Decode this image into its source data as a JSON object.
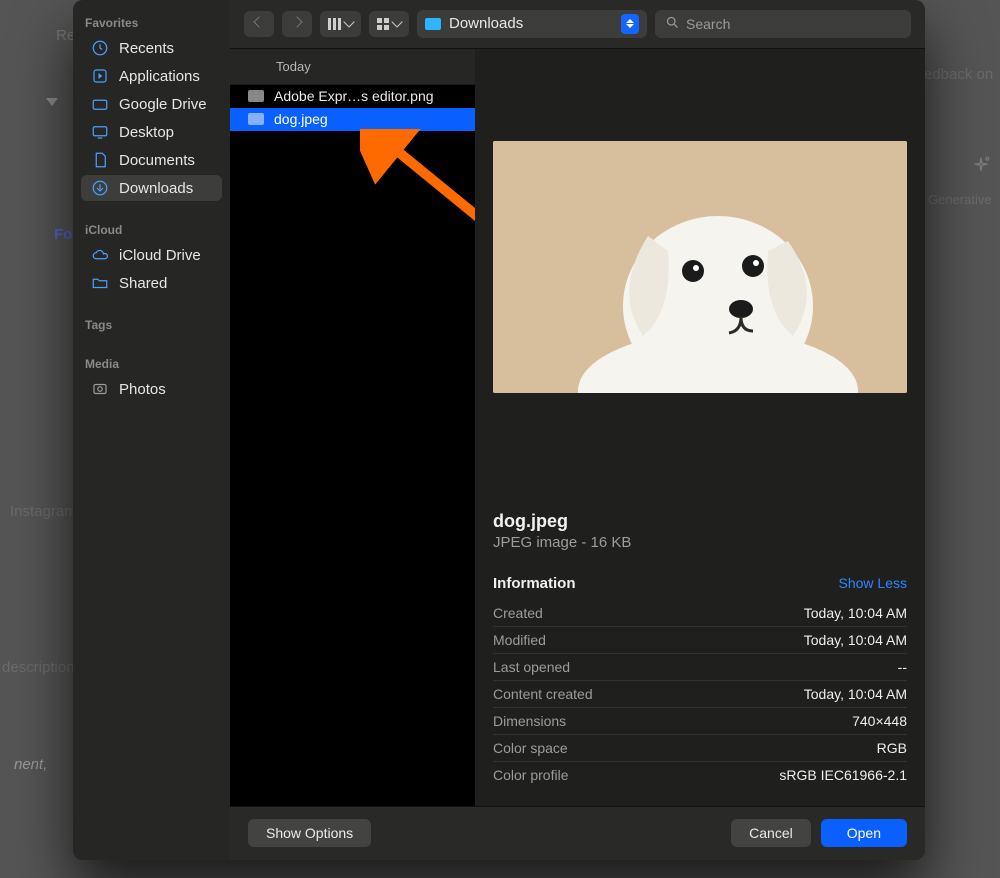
{
  "background": {
    "instagram": "Instagram",
    "description": "description",
    "feedback": "edback on",
    "generative": "Generative",
    "fo": "Fo",
    "ment": "nent,",
    "re": "Re"
  },
  "sidebar": {
    "sections": {
      "favorites": "Favorites",
      "icloud": "iCloud",
      "tags": "Tags",
      "media": "Media"
    },
    "items": {
      "recents": "Recents",
      "applications": "Applications",
      "gdrive": "Google Drive",
      "desktop": "Desktop",
      "documents": "Documents",
      "downloads": "Downloads",
      "iclouddrive": "iCloud Drive",
      "shared": "Shared",
      "photos": "Photos"
    }
  },
  "toolbar": {
    "location": "Downloads",
    "search_placeholder": "Search"
  },
  "filelist": {
    "header": "Today",
    "items": {
      "row0": "Adobe Expr…s editor.png",
      "row1": "dog.jpeg"
    }
  },
  "preview": {
    "filename": "dog.jpeg",
    "kind": "JPEG image - 16 KB",
    "info_title": "Information",
    "show_less": "Show Less",
    "rows": {
      "created": {
        "k": "Created",
        "v": "Today, 10:04 AM"
      },
      "modified": {
        "k": "Modified",
        "v": "Today, 10:04 AM"
      },
      "last_opened": {
        "k": "Last opened",
        "v": "--"
      },
      "content_created": {
        "k": "Content created",
        "v": "Today, 10:04 AM"
      },
      "dimensions": {
        "k": "Dimensions",
        "v": "740×448"
      },
      "color_space": {
        "k": "Color space",
        "v": "RGB"
      },
      "color_profile": {
        "k": "Color profile",
        "v": "sRGB IEC61966-2.1"
      }
    }
  },
  "footer": {
    "show_options": "Show Options",
    "cancel": "Cancel",
    "open": "Open"
  }
}
